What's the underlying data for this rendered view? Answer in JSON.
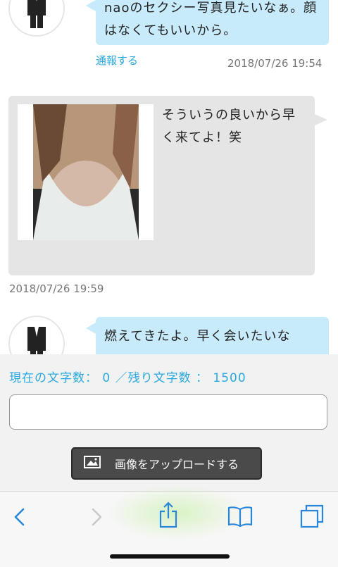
{
  "messages": [
    {
      "side": "right",
      "text_line1": "naoのセクシー写真見たいなぁ。顔",
      "text_line2": "はなくてもいいから。",
      "report_label": "通報する",
      "timestamp": "2018/07/26 19:54"
    },
    {
      "side": "left",
      "text_line1": "そういうの良いから早",
      "text_line2": "く来てよ！笑",
      "timestamp": "2018/07/26 19:59"
    },
    {
      "side": "right",
      "text_line1": "燃えてきたよ。早く会いたいな"
    }
  ],
  "composer": {
    "char_count": "現在の文字数： 0 ／残り文字数 ： 1500",
    "input_value": "",
    "upload_label": "画像をアップロードする"
  },
  "toolbar": {
    "icons": [
      "back-icon",
      "forward-icon",
      "share-icon",
      "bookmarks-icon",
      "tabs-icon"
    ]
  },
  "colors": {
    "accent": "#2aa9e0",
    "bubble_right": "#c7ebfa",
    "bubble_left": "#e5e5e5"
  }
}
